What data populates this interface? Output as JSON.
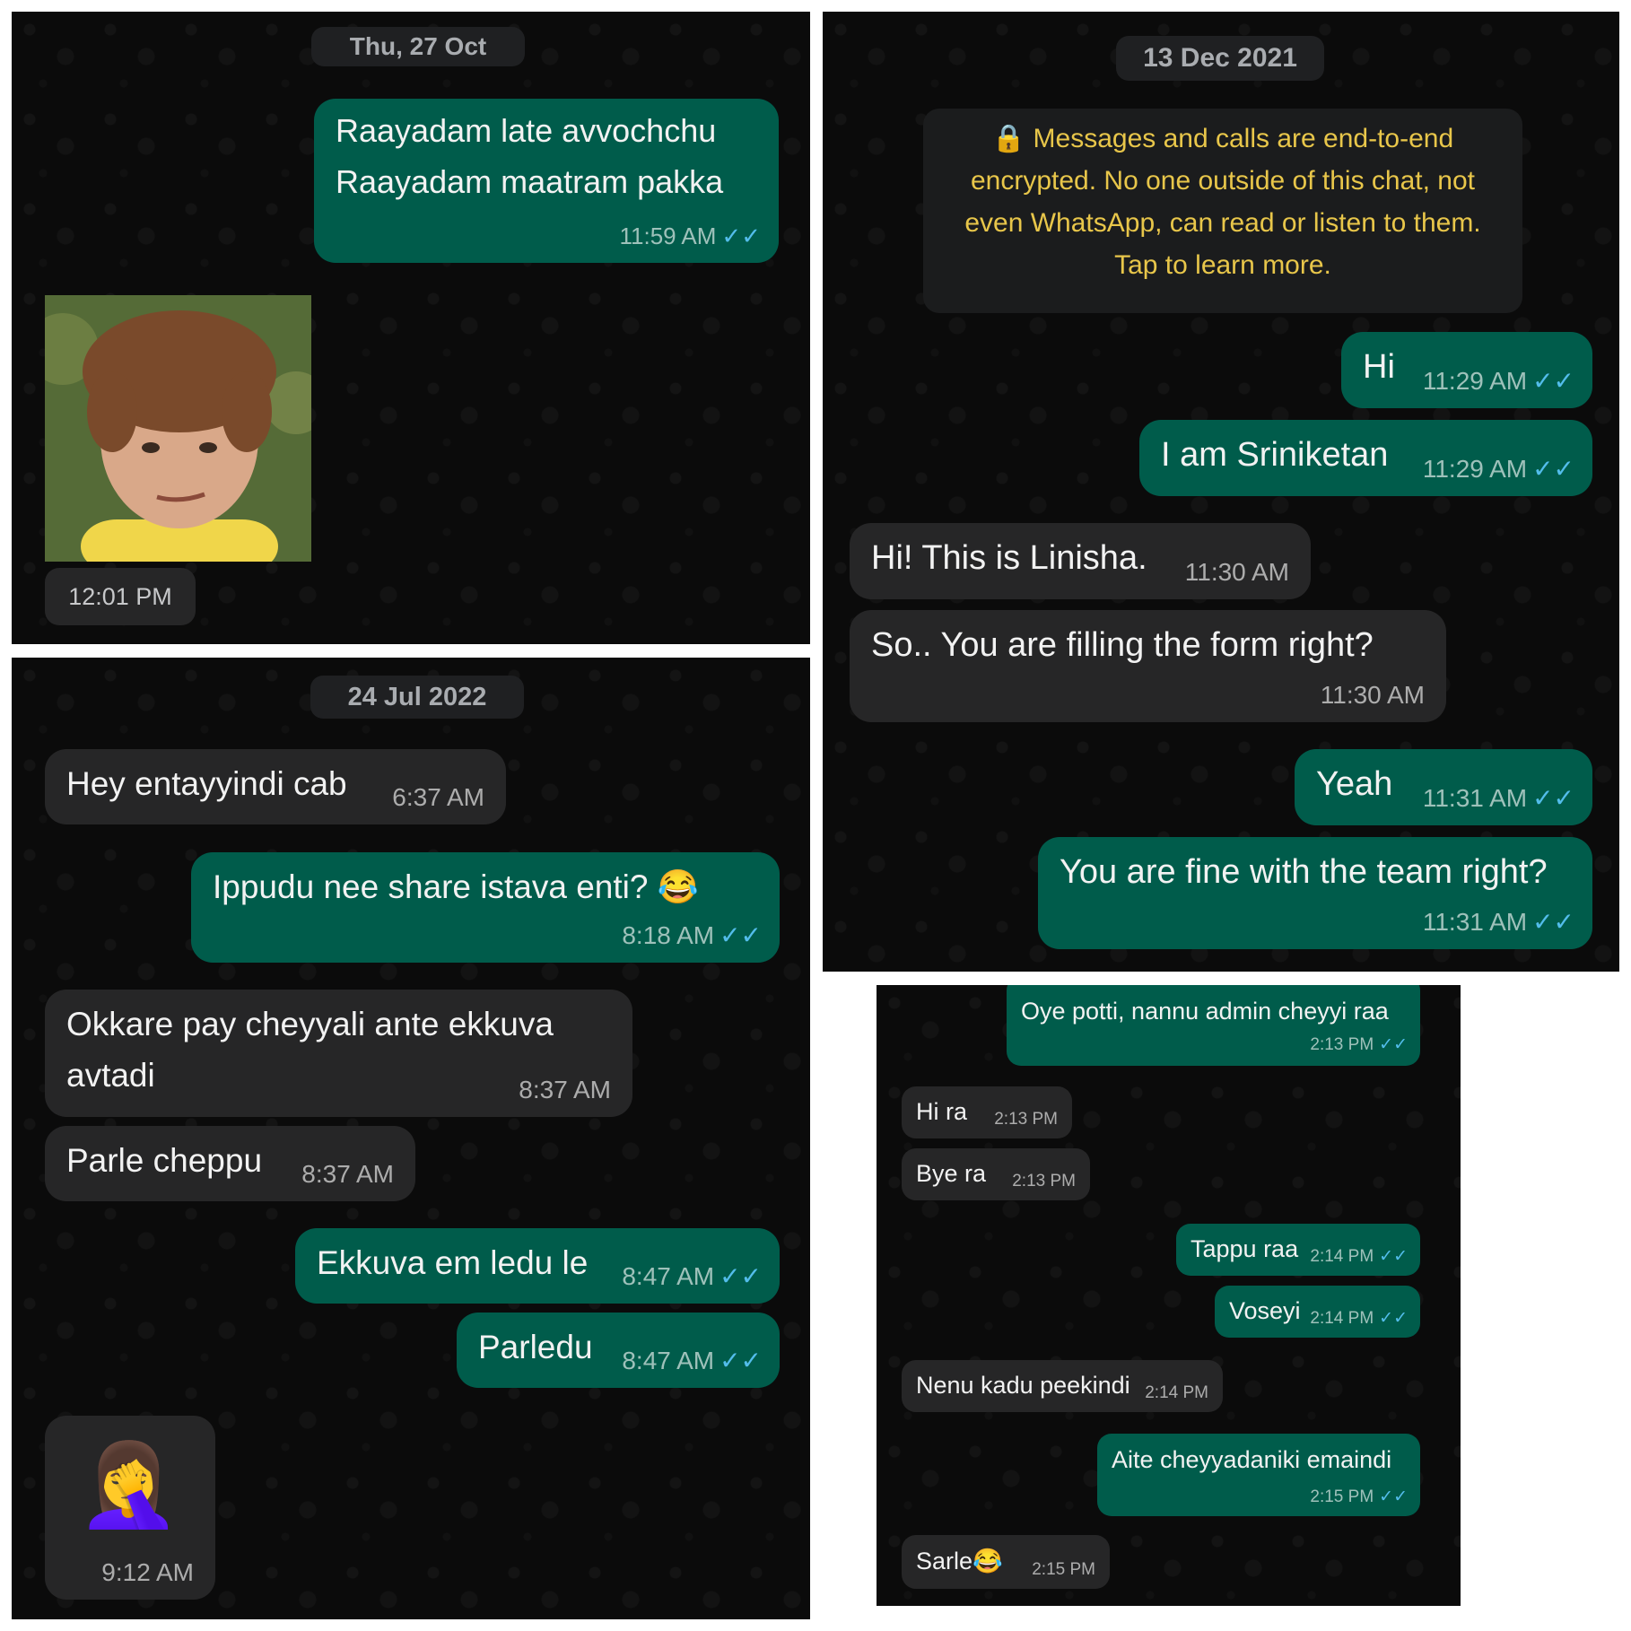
{
  "panel1": {
    "date": "Thu, 27 Oct",
    "msg1": {
      "line1": "Raayadam late avvochchu",
      "line2": "Raayadam maatram pakka",
      "time": "11:59 AM"
    },
    "photo_time": "12:01 PM"
  },
  "panel2": {
    "date": "13 Dec 2021",
    "encryption": {
      "line1": "Messages and calls are end-to-end",
      "line2": "encrypted. No one outside of this chat, not",
      "line3": "even WhatsApp, can read or listen to them.",
      "line4": "Tap to learn more."
    },
    "messages": [
      {
        "text": "Hi",
        "time": "11:29 AM"
      },
      {
        "text": "I am Sriniketan",
        "time": "11:29 AM"
      },
      {
        "text": "Hi! This is Linisha.",
        "time": "11:30 AM"
      },
      {
        "text": "So.. You are filling the form right?",
        "time": "11:30 AM"
      },
      {
        "text": "Yeah",
        "time": "11:31 AM"
      },
      {
        "text": "You are fine with the team right?",
        "time": "11:31 AM"
      }
    ]
  },
  "panel3": {
    "date": "24 Jul 2022",
    "messages": [
      {
        "text": "Hey entayyindi cab",
        "time": "6:37 AM"
      },
      {
        "text": "Ippudu nee share istava enti? 😂",
        "time": "8:18 AM"
      },
      {
        "line1": "Okkare pay cheyyali ante ekkuva",
        "line2": "avtadi",
        "time": "8:37 AM"
      },
      {
        "text": "Parle cheppu",
        "time": "8:37 AM"
      },
      {
        "text": "Ekkuva em ledu le",
        "time": "8:47 AM"
      },
      {
        "text": "Parledu",
        "time": "8:47 AM"
      },
      {
        "emoji": "🤦‍♀️",
        "time": "9:12 AM"
      }
    ]
  },
  "panel4": {
    "messages": [
      {
        "text": "Oye potti, nannu admin cheyyi raa",
        "time": "2:13 PM"
      },
      {
        "text": "Hi ra",
        "time": "2:13 PM"
      },
      {
        "text": "Bye ra",
        "time": "2:13 PM"
      },
      {
        "text": "Tappu raa",
        "time": "2:14 PM"
      },
      {
        "text": "Voseyi",
        "time": "2:14 PM"
      },
      {
        "text": "Nenu kadu peekindi",
        "time": "2:14 PM"
      },
      {
        "text": "Aite cheyyadaniki emaindi",
        "time": "2:15 PM"
      },
      {
        "text": "Sarle😂",
        "time": "2:15 PM"
      }
    ]
  },
  "colors": {
    "outgoing": "#005c4b",
    "incoming": "#262627",
    "ticks": "#53bdeb",
    "encryption_text": "#e8c64a"
  },
  "icons": {
    "read_receipt": "double-check-icon",
    "lock": "lock-icon"
  }
}
